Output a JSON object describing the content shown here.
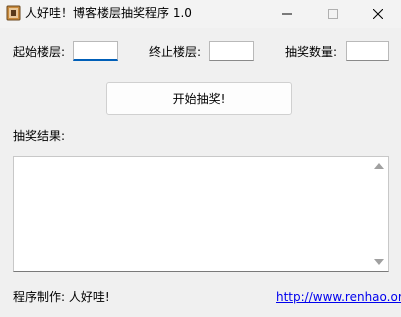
{
  "window": {
    "title": "人好哇！博客楼层抽奖程序 1.0"
  },
  "form": {
    "start_floor_label": "起始楼层:",
    "start_floor_value": "",
    "end_floor_label": "终止楼层:",
    "end_floor_value": "",
    "prize_count_label": "抽奖数量:",
    "prize_count_value": "",
    "start_button_label": "开始抽奖!",
    "result_label": "抽奖结果:",
    "result_text": ""
  },
  "footer": {
    "credit": "程序制作: 人好哇!",
    "link_text": "http://www.renhao.org"
  }
}
